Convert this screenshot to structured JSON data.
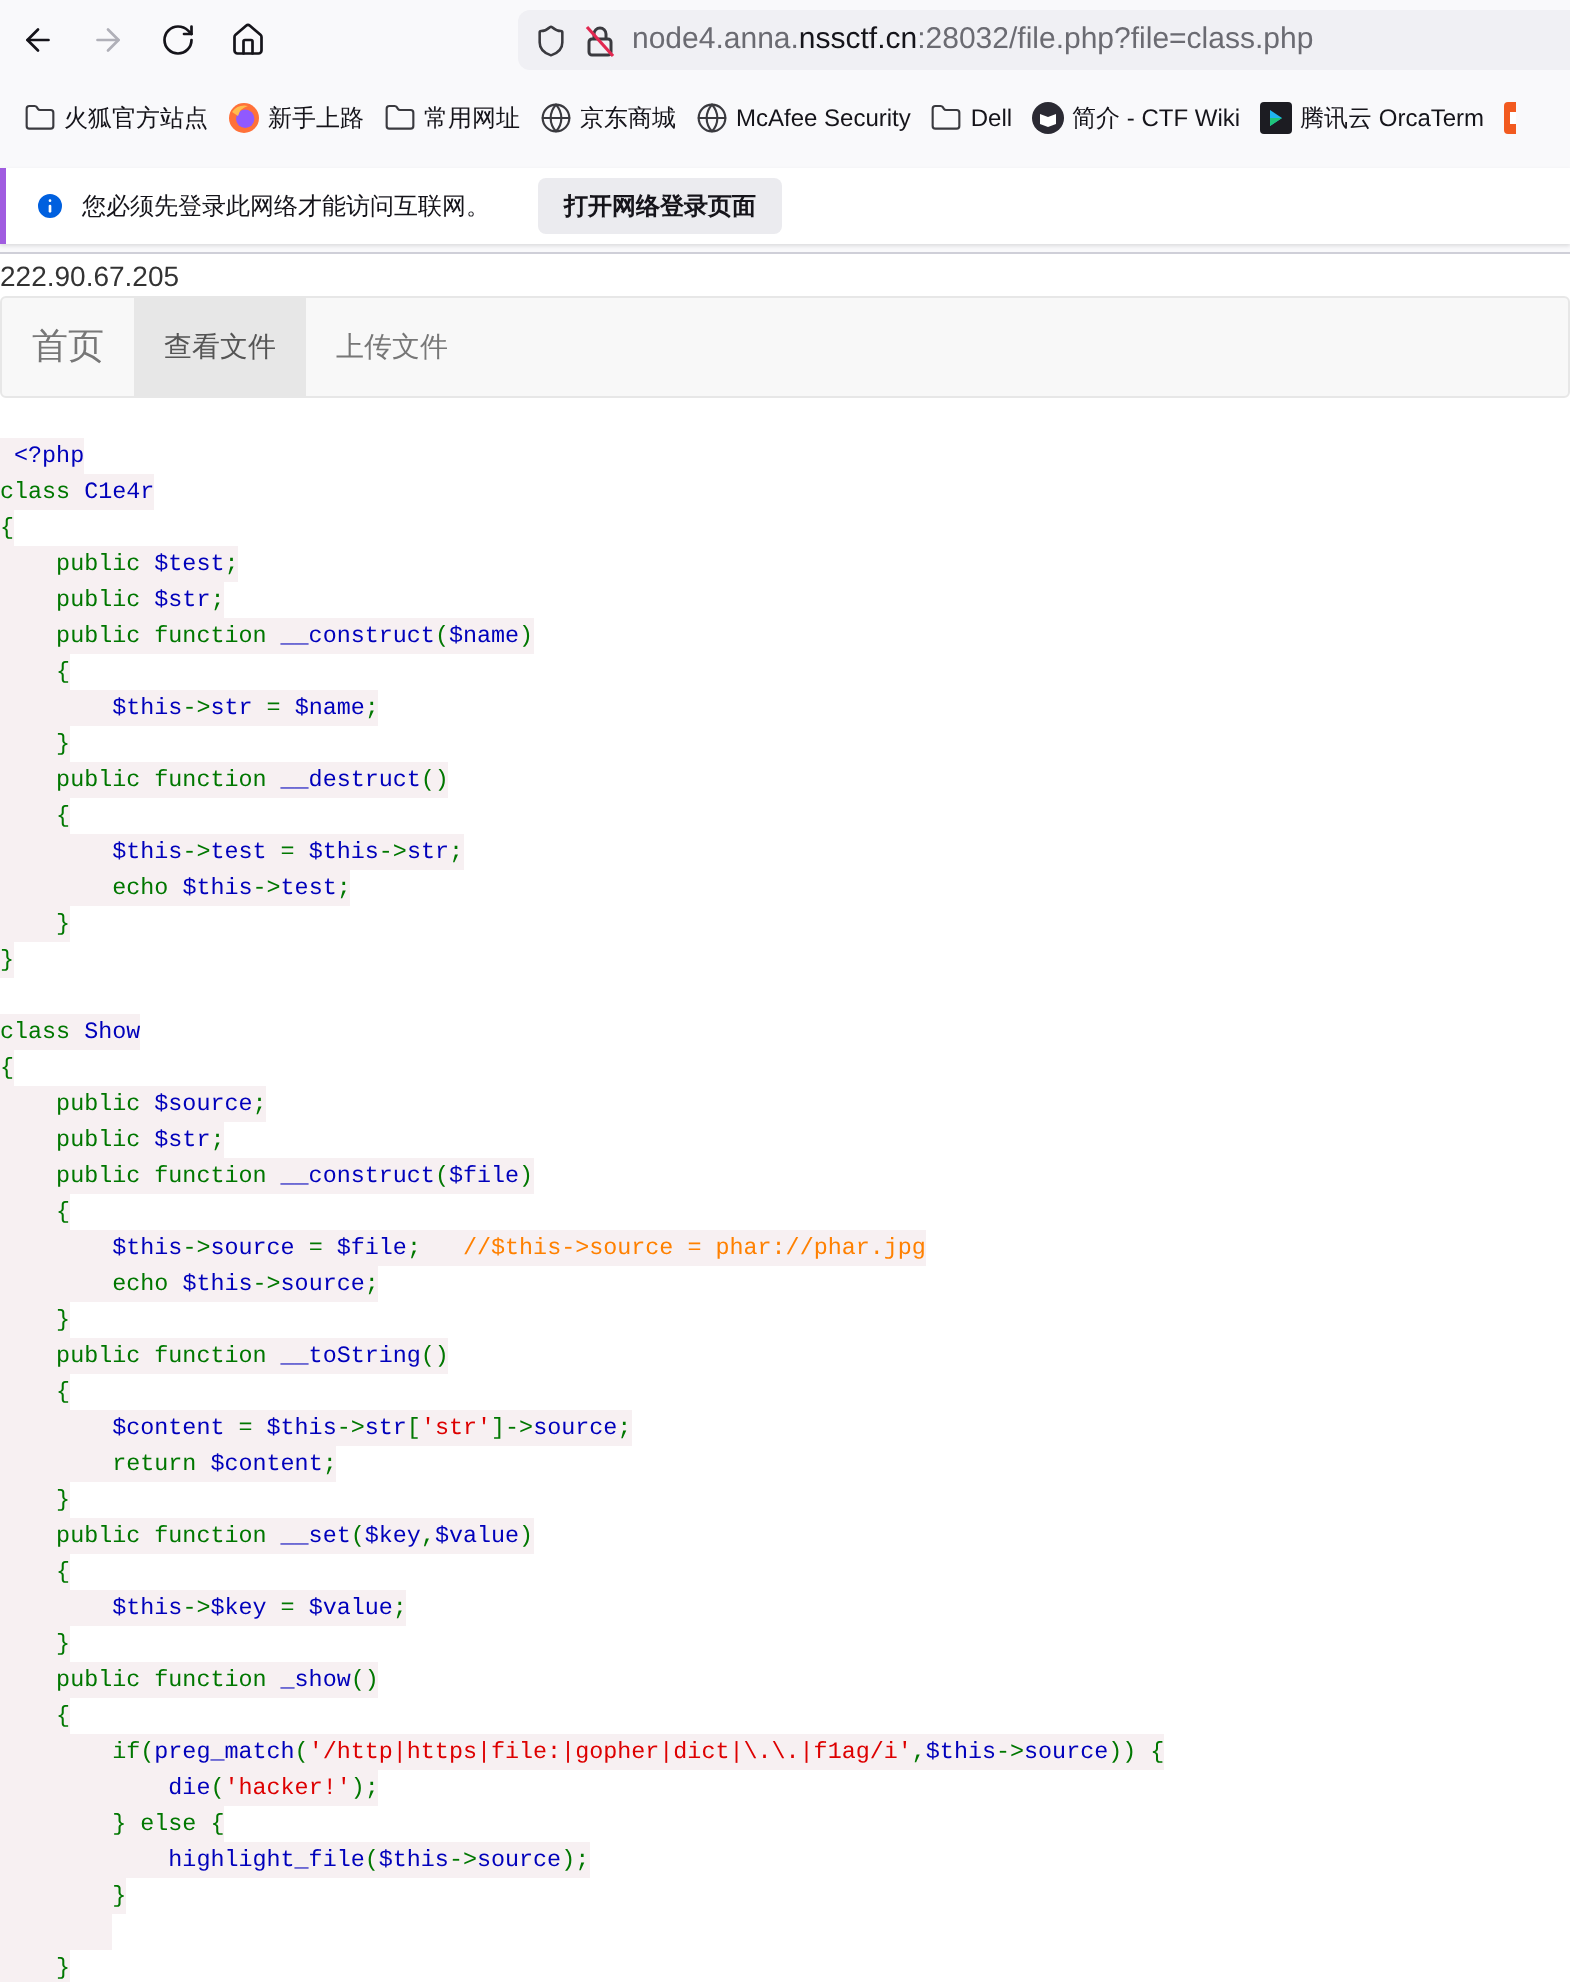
{
  "toolbar": {
    "nav_buttons": [
      {
        "kind": "back",
        "disabled": false
      },
      {
        "kind": "forward",
        "disabled": true
      },
      {
        "kind": "reload",
        "disabled": false
      },
      {
        "kind": "home",
        "disabled": false
      }
    ],
    "url": {
      "prefix": "node4.anna.",
      "domain": "nssctf.cn",
      "suffix": ":28032/file.php?file=class.php"
    }
  },
  "bookmarks": [
    {
      "kind": "folder",
      "label": "火狐官方站点"
    },
    {
      "kind": "firefox",
      "label": "新手上路"
    },
    {
      "kind": "folder",
      "label": "常用网址"
    },
    {
      "kind": "globe",
      "label": "京东商城"
    },
    {
      "kind": "globe",
      "label": "McAfee Security"
    },
    {
      "kind": "folder",
      "label": "Dell"
    },
    {
      "kind": "wiki",
      "label": "简介 - CTF Wiki"
    },
    {
      "kind": "app",
      "label": "腾讯云 OrcaTerm"
    },
    {
      "kind": "orange"
    }
  ],
  "notification": {
    "message": "您必须先登录此网络才能访问互联网。",
    "button": "打开网络登录页面"
  },
  "ip": "222.90.67.205",
  "nav": {
    "brand": "首页",
    "tabs": [
      {
        "label": "查看文件",
        "selected": true
      },
      {
        "label": "上传文件",
        "selected": false
      }
    ]
  },
  "code": [
    {
      "kind": "code",
      "tokens": [
        {
          "kind": "default",
          "text": " <?php"
        }
      ]
    },
    {
      "kind": "code",
      "tokens": [
        {
          "kind": "keyword",
          "text": "class "
        },
        {
          "kind": "default",
          "text": "C1e4r"
        }
      ]
    },
    {
      "kind": "code",
      "tokens": [
        {
          "kind": "keyword",
          "text": "{"
        }
      ]
    },
    {
      "kind": "code",
      "tokens": [
        {
          "kind": "keyword",
          "text": "    public "
        },
        {
          "kind": "default",
          "text": "$test"
        },
        {
          "kind": "keyword",
          "text": ";"
        }
      ]
    },
    {
      "kind": "code",
      "tokens": [
        {
          "kind": "keyword",
          "text": "    public "
        },
        {
          "kind": "default",
          "text": "$str"
        },
        {
          "kind": "keyword",
          "text": ";"
        }
      ]
    },
    {
      "kind": "code",
      "tokens": [
        {
          "kind": "keyword",
          "text": "    public function "
        },
        {
          "kind": "default",
          "text": "__construct"
        },
        {
          "kind": "keyword",
          "text": "("
        },
        {
          "kind": "default",
          "text": "$name"
        },
        {
          "kind": "keyword",
          "text": ")"
        }
      ]
    },
    {
      "kind": "code",
      "tokens": [
        {
          "kind": "keyword",
          "text": "    {"
        }
      ]
    },
    {
      "kind": "code",
      "tokens": [
        {
          "kind": "default",
          "text": "        $this"
        },
        {
          "kind": "keyword",
          "text": "->"
        },
        {
          "kind": "default",
          "text": "str "
        },
        {
          "kind": "keyword",
          "text": "= "
        },
        {
          "kind": "default",
          "text": "$name"
        },
        {
          "kind": "keyword",
          "text": ";"
        }
      ]
    },
    {
      "kind": "code",
      "tokens": [
        {
          "kind": "keyword",
          "text": "    }"
        }
      ]
    },
    {
      "kind": "code",
      "tokens": [
        {
          "kind": "keyword",
          "text": "    public function "
        },
        {
          "kind": "default",
          "text": "__destruct"
        },
        {
          "kind": "keyword",
          "text": "()"
        }
      ]
    },
    {
      "kind": "code",
      "tokens": [
        {
          "kind": "keyword",
          "text": "    {"
        }
      ]
    },
    {
      "kind": "code",
      "tokens": [
        {
          "kind": "default",
          "text": "        $this"
        },
        {
          "kind": "keyword",
          "text": "->"
        },
        {
          "kind": "default",
          "text": "test "
        },
        {
          "kind": "keyword",
          "text": "= "
        },
        {
          "kind": "default",
          "text": "$this"
        },
        {
          "kind": "keyword",
          "text": "->"
        },
        {
          "kind": "default",
          "text": "str"
        },
        {
          "kind": "keyword",
          "text": ";"
        }
      ]
    },
    {
      "kind": "code",
      "tokens": [
        {
          "kind": "keyword",
          "text": "        echo "
        },
        {
          "kind": "default",
          "text": "$this"
        },
        {
          "kind": "keyword",
          "text": "->"
        },
        {
          "kind": "default",
          "text": "test"
        },
        {
          "kind": "keyword",
          "text": ";"
        }
      ]
    },
    {
      "kind": "code",
      "tokens": [
        {
          "kind": "keyword",
          "text": "    }"
        }
      ]
    },
    {
      "kind": "code",
      "tokens": [
        {
          "kind": "keyword",
          "text": "}"
        }
      ]
    },
    {
      "kind": "blank"
    },
    {
      "kind": "code",
      "tokens": [
        {
          "kind": "keyword",
          "text": "class "
        },
        {
          "kind": "default",
          "text": "Show"
        }
      ]
    },
    {
      "kind": "code",
      "tokens": [
        {
          "kind": "keyword",
          "text": "{"
        }
      ]
    },
    {
      "kind": "code",
      "tokens": [
        {
          "kind": "keyword",
          "text": "    public "
        },
        {
          "kind": "default",
          "text": "$source"
        },
        {
          "kind": "keyword",
          "text": ";"
        }
      ]
    },
    {
      "kind": "code",
      "tokens": [
        {
          "kind": "keyword",
          "text": "    public "
        },
        {
          "kind": "default",
          "text": "$str"
        },
        {
          "kind": "keyword",
          "text": ";"
        }
      ]
    },
    {
      "kind": "code",
      "tokens": [
        {
          "kind": "keyword",
          "text": "    public function "
        },
        {
          "kind": "default",
          "text": "__construct"
        },
        {
          "kind": "keyword",
          "text": "("
        },
        {
          "kind": "default",
          "text": "$file"
        },
        {
          "kind": "keyword",
          "text": ")"
        }
      ]
    },
    {
      "kind": "code",
      "tokens": [
        {
          "kind": "keyword",
          "text": "    {"
        }
      ]
    },
    {
      "kind": "code",
      "tokens": [
        {
          "kind": "default",
          "text": "        $this"
        },
        {
          "kind": "keyword",
          "text": "->"
        },
        {
          "kind": "default",
          "text": "source "
        },
        {
          "kind": "keyword",
          "text": "= "
        },
        {
          "kind": "default",
          "text": "$file"
        },
        {
          "kind": "keyword",
          "text": ";"
        },
        {
          "kind": "comment",
          "text": "   //$this->source = phar://phar.jpg"
        }
      ]
    },
    {
      "kind": "code",
      "tokens": [
        {
          "kind": "keyword",
          "text": "        echo "
        },
        {
          "kind": "default",
          "text": "$this"
        },
        {
          "kind": "keyword",
          "text": "->"
        },
        {
          "kind": "default",
          "text": "source"
        },
        {
          "kind": "keyword",
          "text": ";"
        }
      ]
    },
    {
      "kind": "code",
      "tokens": [
        {
          "kind": "keyword",
          "text": "    }"
        }
      ]
    },
    {
      "kind": "code",
      "tokens": [
        {
          "kind": "keyword",
          "text": "    public function "
        },
        {
          "kind": "default",
          "text": "__toString"
        },
        {
          "kind": "keyword",
          "text": "()"
        }
      ]
    },
    {
      "kind": "code",
      "tokens": [
        {
          "kind": "keyword",
          "text": "    {"
        }
      ]
    },
    {
      "kind": "code",
      "tokens": [
        {
          "kind": "default",
          "text": "        $content "
        },
        {
          "kind": "keyword",
          "text": "= "
        },
        {
          "kind": "default",
          "text": "$this"
        },
        {
          "kind": "keyword",
          "text": "->"
        },
        {
          "kind": "default",
          "text": "str"
        },
        {
          "kind": "keyword",
          "text": "["
        },
        {
          "kind": "string",
          "text": "'str'"
        },
        {
          "kind": "keyword",
          "text": "]->"
        },
        {
          "kind": "default",
          "text": "source"
        },
        {
          "kind": "keyword",
          "text": ";"
        }
      ]
    },
    {
      "kind": "code",
      "tokens": [
        {
          "kind": "keyword",
          "text": "        return "
        },
        {
          "kind": "default",
          "text": "$content"
        },
        {
          "kind": "keyword",
          "text": ";"
        }
      ]
    },
    {
      "kind": "code",
      "tokens": [
        {
          "kind": "keyword",
          "text": "    }"
        }
      ]
    },
    {
      "kind": "code",
      "tokens": [
        {
          "kind": "keyword",
          "text": "    public function "
        },
        {
          "kind": "default",
          "text": "__set"
        },
        {
          "kind": "keyword",
          "text": "("
        },
        {
          "kind": "default",
          "text": "$key"
        },
        {
          "kind": "keyword",
          "text": ","
        },
        {
          "kind": "default",
          "text": "$value"
        },
        {
          "kind": "keyword",
          "text": ")"
        }
      ]
    },
    {
      "kind": "code",
      "tokens": [
        {
          "kind": "keyword",
          "text": "    {"
        }
      ]
    },
    {
      "kind": "code",
      "tokens": [
        {
          "kind": "default",
          "text": "        $this"
        },
        {
          "kind": "keyword",
          "text": "->"
        },
        {
          "kind": "default",
          "text": "$key "
        },
        {
          "kind": "keyword",
          "text": "= "
        },
        {
          "kind": "default",
          "text": "$value"
        },
        {
          "kind": "keyword",
          "text": ";"
        }
      ]
    },
    {
      "kind": "code",
      "tokens": [
        {
          "kind": "keyword",
          "text": "    }"
        }
      ]
    },
    {
      "kind": "code",
      "tokens": [
        {
          "kind": "keyword",
          "text": "    public function "
        },
        {
          "kind": "default",
          "text": "_show"
        },
        {
          "kind": "keyword",
          "text": "()"
        }
      ]
    },
    {
      "kind": "code",
      "tokens": [
        {
          "kind": "keyword",
          "text": "    {"
        }
      ]
    },
    {
      "kind": "code",
      "tokens": [
        {
          "kind": "keyword",
          "text": "        if("
        },
        {
          "kind": "default",
          "text": "preg_match"
        },
        {
          "kind": "keyword",
          "text": "("
        },
        {
          "kind": "string",
          "text": "'/http|https|file:|gopher|dict|\\.\\.|f1ag/i'"
        },
        {
          "kind": "keyword",
          "text": ","
        },
        {
          "kind": "default",
          "text": "$this"
        },
        {
          "kind": "keyword",
          "text": "->"
        },
        {
          "kind": "default",
          "text": "source"
        },
        {
          "kind": "keyword",
          "text": ")) {"
        }
      ]
    },
    {
      "kind": "code",
      "tokens": [
        {
          "kind": "default",
          "text": "            die"
        },
        {
          "kind": "keyword",
          "text": "("
        },
        {
          "kind": "string",
          "text": "'hacker!'"
        },
        {
          "kind": "keyword",
          "text": ");"
        }
      ]
    },
    {
      "kind": "code",
      "tokens": [
        {
          "kind": "keyword",
          "text": "        } else {"
        }
      ]
    },
    {
      "kind": "code",
      "tokens": [
        {
          "kind": "default",
          "text": "            highlight_file"
        },
        {
          "kind": "keyword",
          "text": "("
        },
        {
          "kind": "default",
          "text": "$this"
        },
        {
          "kind": "keyword",
          "text": "->"
        },
        {
          "kind": "default",
          "text": "source"
        },
        {
          "kind": "keyword",
          "text": ");"
        }
      ]
    },
    {
      "kind": "code",
      "tokens": [
        {
          "kind": "keyword",
          "text": "        }"
        }
      ]
    },
    {
      "kind": "shaded_blank"
    },
    {
      "kind": "code",
      "tokens": [
        {
          "kind": "keyword",
          "text": "    }"
        }
      ]
    }
  ]
}
